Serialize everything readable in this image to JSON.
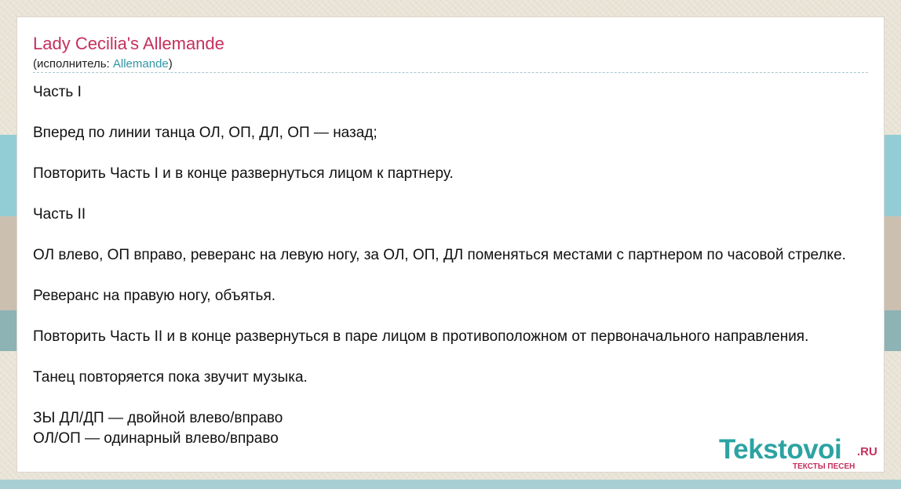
{
  "song": {
    "title": "Lady Cecilia's Allemande",
    "performer_prefix": "(исполнитель: ",
    "performer_name": "Allemande",
    "performer_suffix": ")"
  },
  "lyrics": [
    "Часть I",
    "",
    "Вперед по линии танца ОЛ, ОП, ДЛ, ОП — назад;",
    "",
    "Повторить Часть I и в конце развернуться лицом к партнеру.",
    "",
    "Часть II",
    "",
    "ОЛ влево, ОП вправо, реверанс на левую ногу, за ОЛ, ОП, ДЛ поменяться местами с партнером по часовой стрелке.",
    "",
    "Реверанс на правую ногу, объятья.",
    "",
    "Повторить Часть II и в конце развернуться в паре лицом в противоположном от первоначального направления.",
    "",
    "Танец повторяется пока звучит музыка.",
    "",
    "ЗЫ ДЛ/ДП — двойной влево/вправо",
    "ОЛ/ОП — одинарный влево/вправо"
  ],
  "logo": {
    "name": "Tekstovoi",
    "tld": ".RU",
    "tagline": "ТЕКСТЫ ПЕСЕН"
  },
  "colors": {
    "title": "#c5305d",
    "link": "#2f97a6",
    "logo": "#2ba3a2",
    "logo_accent": "#c5305d"
  }
}
